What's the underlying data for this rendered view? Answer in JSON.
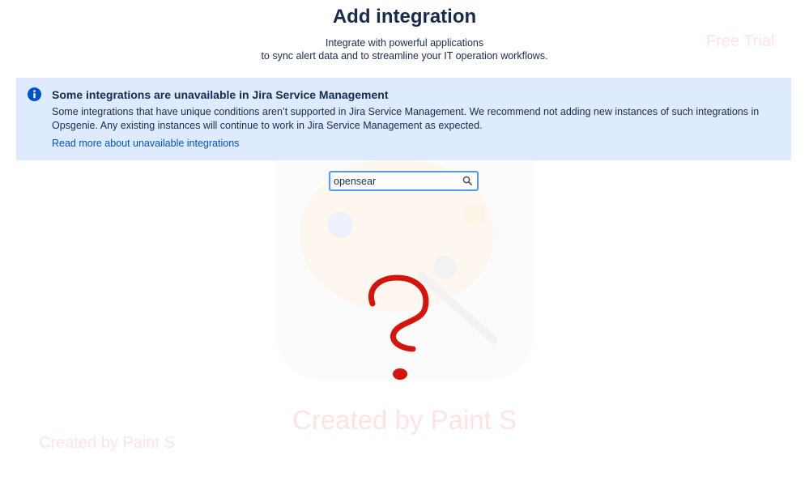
{
  "header": {
    "title": "Add integration",
    "subtitle_line1": "Integrate with powerful applications",
    "subtitle_line2": "to sync alert data and to streamline your IT operation workflows."
  },
  "banner": {
    "icon": "info-icon",
    "heading": "Some integrations are unavailable in Jira Service Management",
    "body": "Some integrations that have unique conditions aren’t supported in Jira Service Management. We recommend not adding new instances of such integrations in Opsgenie. Any existing instances will continue to work in Jira Service Management as expected.",
    "link_label": "Read more about unavailable integrations",
    "background": "#deebff"
  },
  "search": {
    "value": "opensear",
    "icon": "search-icon",
    "focus_color": "#4c9aff"
  },
  "annotation": {
    "icon": "question-mark-icon",
    "color": "#d4150d"
  },
  "watermarks": {
    "top_right": "Free Trial",
    "center": "Created by Paint S",
    "bottom_left": "Created by Paint S"
  },
  "colors": {
    "text": "#172b4d",
    "link": "#0052cc",
    "watermark": "#ffe3e3"
  }
}
